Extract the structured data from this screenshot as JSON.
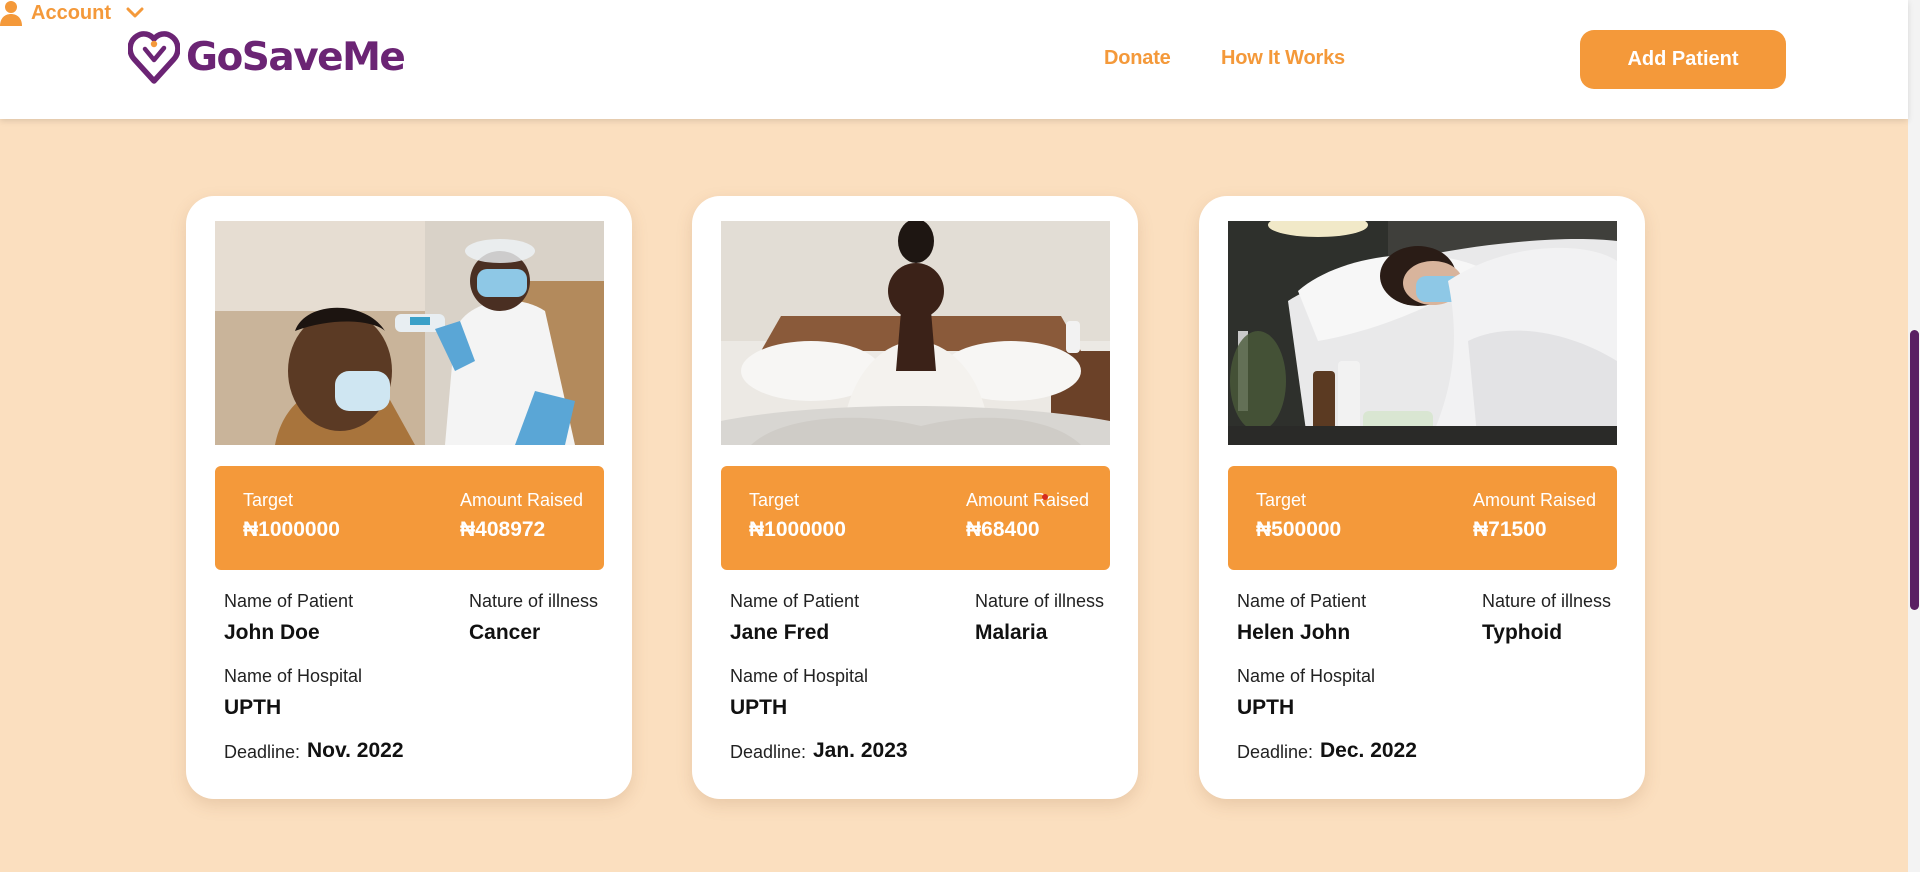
{
  "brand": {
    "name": "GoSaveMe",
    "primary_color": "#6b2474",
    "accent_color": "#f4993a",
    "background_color": "#fbdfbf"
  },
  "nav": {
    "donate_label": "Donate",
    "how_it_works_label": "How It Works",
    "account_label": "Account",
    "add_patient_label": "Add Patient"
  },
  "icons": [
    "heart-logo-icon",
    "user-icon",
    "chevron-down-icon"
  ],
  "cards": [
    {
      "photo": "patient-temperature-check-photo",
      "target_label": "Target",
      "target_value": "₦1000000",
      "raised_label": "Amount Raised",
      "raised_value": "₦408972",
      "patient_label": "Name of Patient",
      "patient_name": "John Doe",
      "illness_label": "Nature of illness",
      "illness": "Cancer",
      "hospital_label": "Name of Hospital",
      "hospital": "UPTH",
      "deadline_label": "Deadline:",
      "deadline": "Nov. 2022"
    },
    {
      "photo": "woman-sick-in-bed-photo",
      "target_label": "Target",
      "target_value": "₦1000000",
      "raised_label": "Amount Raised",
      "raised_value": "₦68400",
      "patient_label": "Name of Patient",
      "patient_name": "Jane Fred",
      "illness_label": "Nature of illness",
      "illness": "Malaria",
      "hospital_label": "Name of Hospital",
      "hospital": "UPTH",
      "deadline_label": "Deadline:",
      "deadline": "Jan. 2023"
    },
    {
      "photo": "woman-masked-sleeping-photo",
      "target_label": "Target",
      "target_value": "₦500000",
      "raised_label": "Amount Raised",
      "raised_value": "₦71500",
      "patient_label": "Name of Patient",
      "patient_name": "Helen John",
      "illness_label": "Nature of illness",
      "illness": "Typhoid",
      "hospital_label": "Name of Hospital",
      "hospital": "UPTH",
      "deadline_label": "Deadline:",
      "deadline": "Dec. 2022"
    }
  ]
}
